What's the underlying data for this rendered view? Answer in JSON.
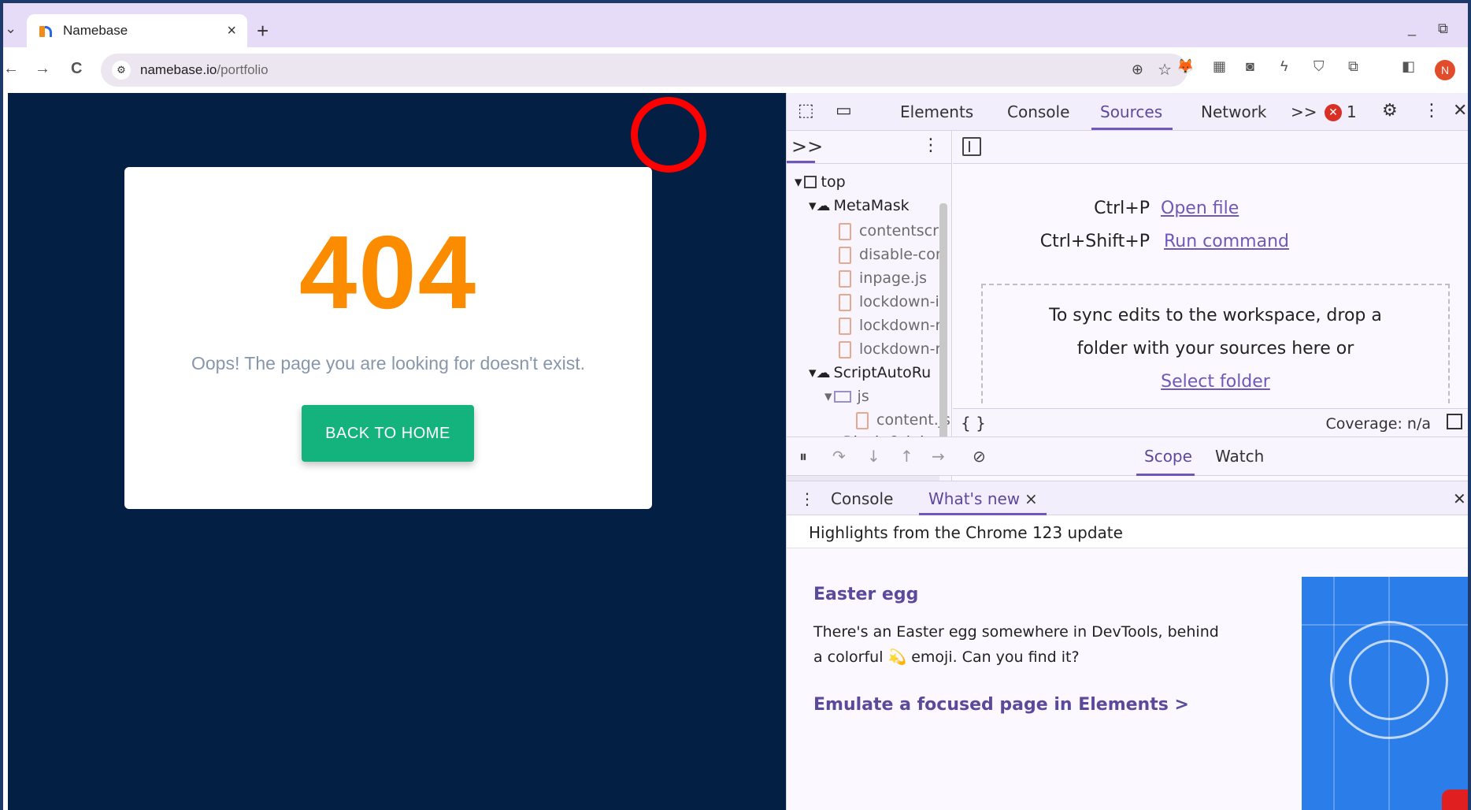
{
  "browser": {
    "tab": {
      "title": "Namebase",
      "close": "×"
    },
    "new_tab": "+",
    "window": {
      "minimize": "_",
      "restore": "⧉"
    },
    "nav": {
      "back": "←",
      "forward": "→",
      "reload": "C"
    },
    "address": {
      "host": "namebase.io",
      "path": "/portfolio"
    },
    "avatar_letter": "N",
    "extensions": [
      "metamask-icon",
      "qr-icon",
      "camera-icon",
      "bolt-icon",
      "shield-icon",
      "puzzle-icon"
    ]
  },
  "page": {
    "error_code": "404",
    "message": "Oops! The page you are looking for doesn't exist.",
    "back_button": "BACK TO HOME",
    "colors": {
      "background": "#031f43",
      "code": "#fb8c00",
      "button": "#14b37d"
    }
  },
  "devtools": {
    "tabs": [
      "Elements",
      "Console",
      "Sources",
      "Network"
    ],
    "active_tab": "Sources",
    "more_tabs": ">>",
    "error_count": "1",
    "navigator": {
      "more": ">>",
      "tree": {
        "top": "top",
        "metamask": "MetaMask",
        "files": [
          "contentscri",
          "disable-con",
          "inpage.js",
          "lockdown-ii",
          "lockdown-r",
          "lockdown-r"
        ],
        "scriptautorun": "ScriptAutoRu",
        "js_folder": "js",
        "content_file": "content.js",
        "ublock": "uBlock Origin"
      }
    },
    "editor": {
      "shortcut1_key": "Ctrl+P",
      "shortcut1_action": "Open file",
      "shortcut2_key": "Ctrl+Shift+P",
      "shortcut2_action": "Run command",
      "dropzone_line1": "To sync edits to the workspace, drop a",
      "dropzone_line2": "folder with your sources here or",
      "dropzone_link": "Select folder",
      "braces": "{ }",
      "coverage": "Coverage: n/a"
    },
    "debugger": {
      "tabs": [
        "Scope",
        "Watch"
      ],
      "active_tab": "Scope"
    },
    "drawer": {
      "tabs": [
        "Console",
        "What's new"
      ],
      "active_tab": "What's new",
      "close": "×",
      "highlights": "Highlights from the Chrome 123 update",
      "sections": [
        {
          "heading": "Easter egg",
          "body_line1": "There's an Easter egg somewhere in DevTools, behind",
          "body_line2": "a colorful 💫 emoji. Can you find it?"
        },
        {
          "heading": "Emulate a focused page in Elements >"
        }
      ]
    },
    "accent": "#6e58b8"
  }
}
